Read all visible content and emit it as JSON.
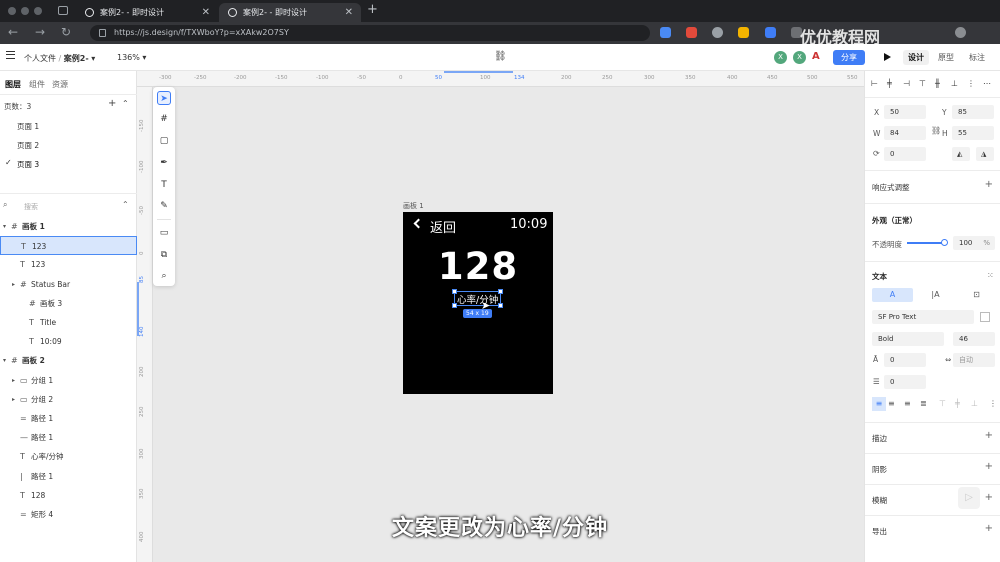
{
  "browser": {
    "tabs": [
      {
        "label": "案例2- - 即时设计",
        "active": false
      },
      {
        "label": "案例2- - 即时设计",
        "active": true
      }
    ],
    "url": "https://js.design/f/TXWboY?p=xXAkw2O7SY"
  },
  "watermark": "优优教程网",
  "topbar": {
    "breadcrumb_root": "个人文件",
    "breadcrumb_sep": "/",
    "breadcrumb_file": "案例2-",
    "zoom": "136%",
    "avatar1": "X",
    "avatar2": "X",
    "share_label": "分享",
    "mode_tabs": [
      "设计",
      "原型",
      "标注"
    ]
  },
  "left_panel": {
    "tabs": [
      "图层",
      "组件",
      "资源"
    ],
    "pages_label": "页数：3",
    "pages": [
      "页面 1",
      "页面 2",
      "页面 3"
    ],
    "search_placeholder": "搜索",
    "layers": [
      {
        "icon": "#",
        "label": "画板 1",
        "indent": 0,
        "bold": true
      },
      {
        "icon": "T",
        "label": "123",
        "indent": 1,
        "selected": true
      },
      {
        "icon": "T",
        "label": "123",
        "indent": 1
      },
      {
        "icon": "#",
        "label": "Status Bar",
        "indent": 1
      },
      {
        "icon": "#",
        "label": "画板 3",
        "indent": 2
      },
      {
        "icon": "T",
        "label": "Title",
        "indent": 2
      },
      {
        "icon": "T",
        "label": "10:09",
        "indent": 2
      },
      {
        "icon": "#",
        "label": "画板 2",
        "indent": 0,
        "bold": true
      },
      {
        "icon": "▭",
        "label": "分组 1",
        "indent": 1
      },
      {
        "icon": "▭",
        "label": "分组 2",
        "indent": 1
      },
      {
        "icon": "=",
        "label": "路径 1",
        "indent": 1
      },
      {
        "icon": "—",
        "label": "路径 1",
        "indent": 1
      },
      {
        "icon": "T",
        "label": "心率/分钟",
        "indent": 1
      },
      {
        "icon": "|",
        "label": "路径 1",
        "indent": 1
      },
      {
        "icon": "T",
        "label": "128",
        "indent": 1
      },
      {
        "icon": "=",
        "label": "矩形 4",
        "indent": 1
      }
    ]
  },
  "rulers": {
    "h": [
      "-300",
      "-250",
      "-200",
      "-150",
      "-100",
      "-50",
      "0",
      "50",
      "100",
      "134",
      "200",
      "250",
      "300",
      "350",
      "400",
      "450",
      "500",
      "550"
    ],
    "v": [
      "-150",
      "-100",
      "-50",
      "0",
      "85",
      "140",
      "200",
      "250",
      "300",
      "350",
      "400"
    ]
  },
  "artboard": {
    "label": "画板 1",
    "back": "返回",
    "time": "10:09",
    "value": "128",
    "unit": "心率/分钟",
    "size_badge": "54 x 19"
  },
  "right_panel": {
    "x": "50",
    "y": "85",
    "w": "84",
    "h": "55",
    "rotation": "0",
    "x_label": "X",
    "y_label": "Y",
    "w_label": "W",
    "h_label": "H",
    "responsive_label": "响应式调整",
    "appearance_label": "外观（正常）",
    "opacity_label": "不透明度",
    "opacity_value": "100",
    "opacity_unit": "%",
    "opacity": 1.0,
    "text_label": "文本",
    "font_family": "SF Pro Text",
    "font_weight": "Bold",
    "font_size": "46",
    "line_height": "0",
    "auto_label": "自动",
    "para_spacing": "0",
    "stroke_label": "描边",
    "shadow_label": "阴影",
    "blur_label": "模糊",
    "export_label": "导出"
  },
  "subtitle": "文案更改为心率/分钟",
  "colors": {
    "accent": "#3f7df6",
    "avatar": "#53a77c",
    "selection": "#4a8af4"
  }
}
